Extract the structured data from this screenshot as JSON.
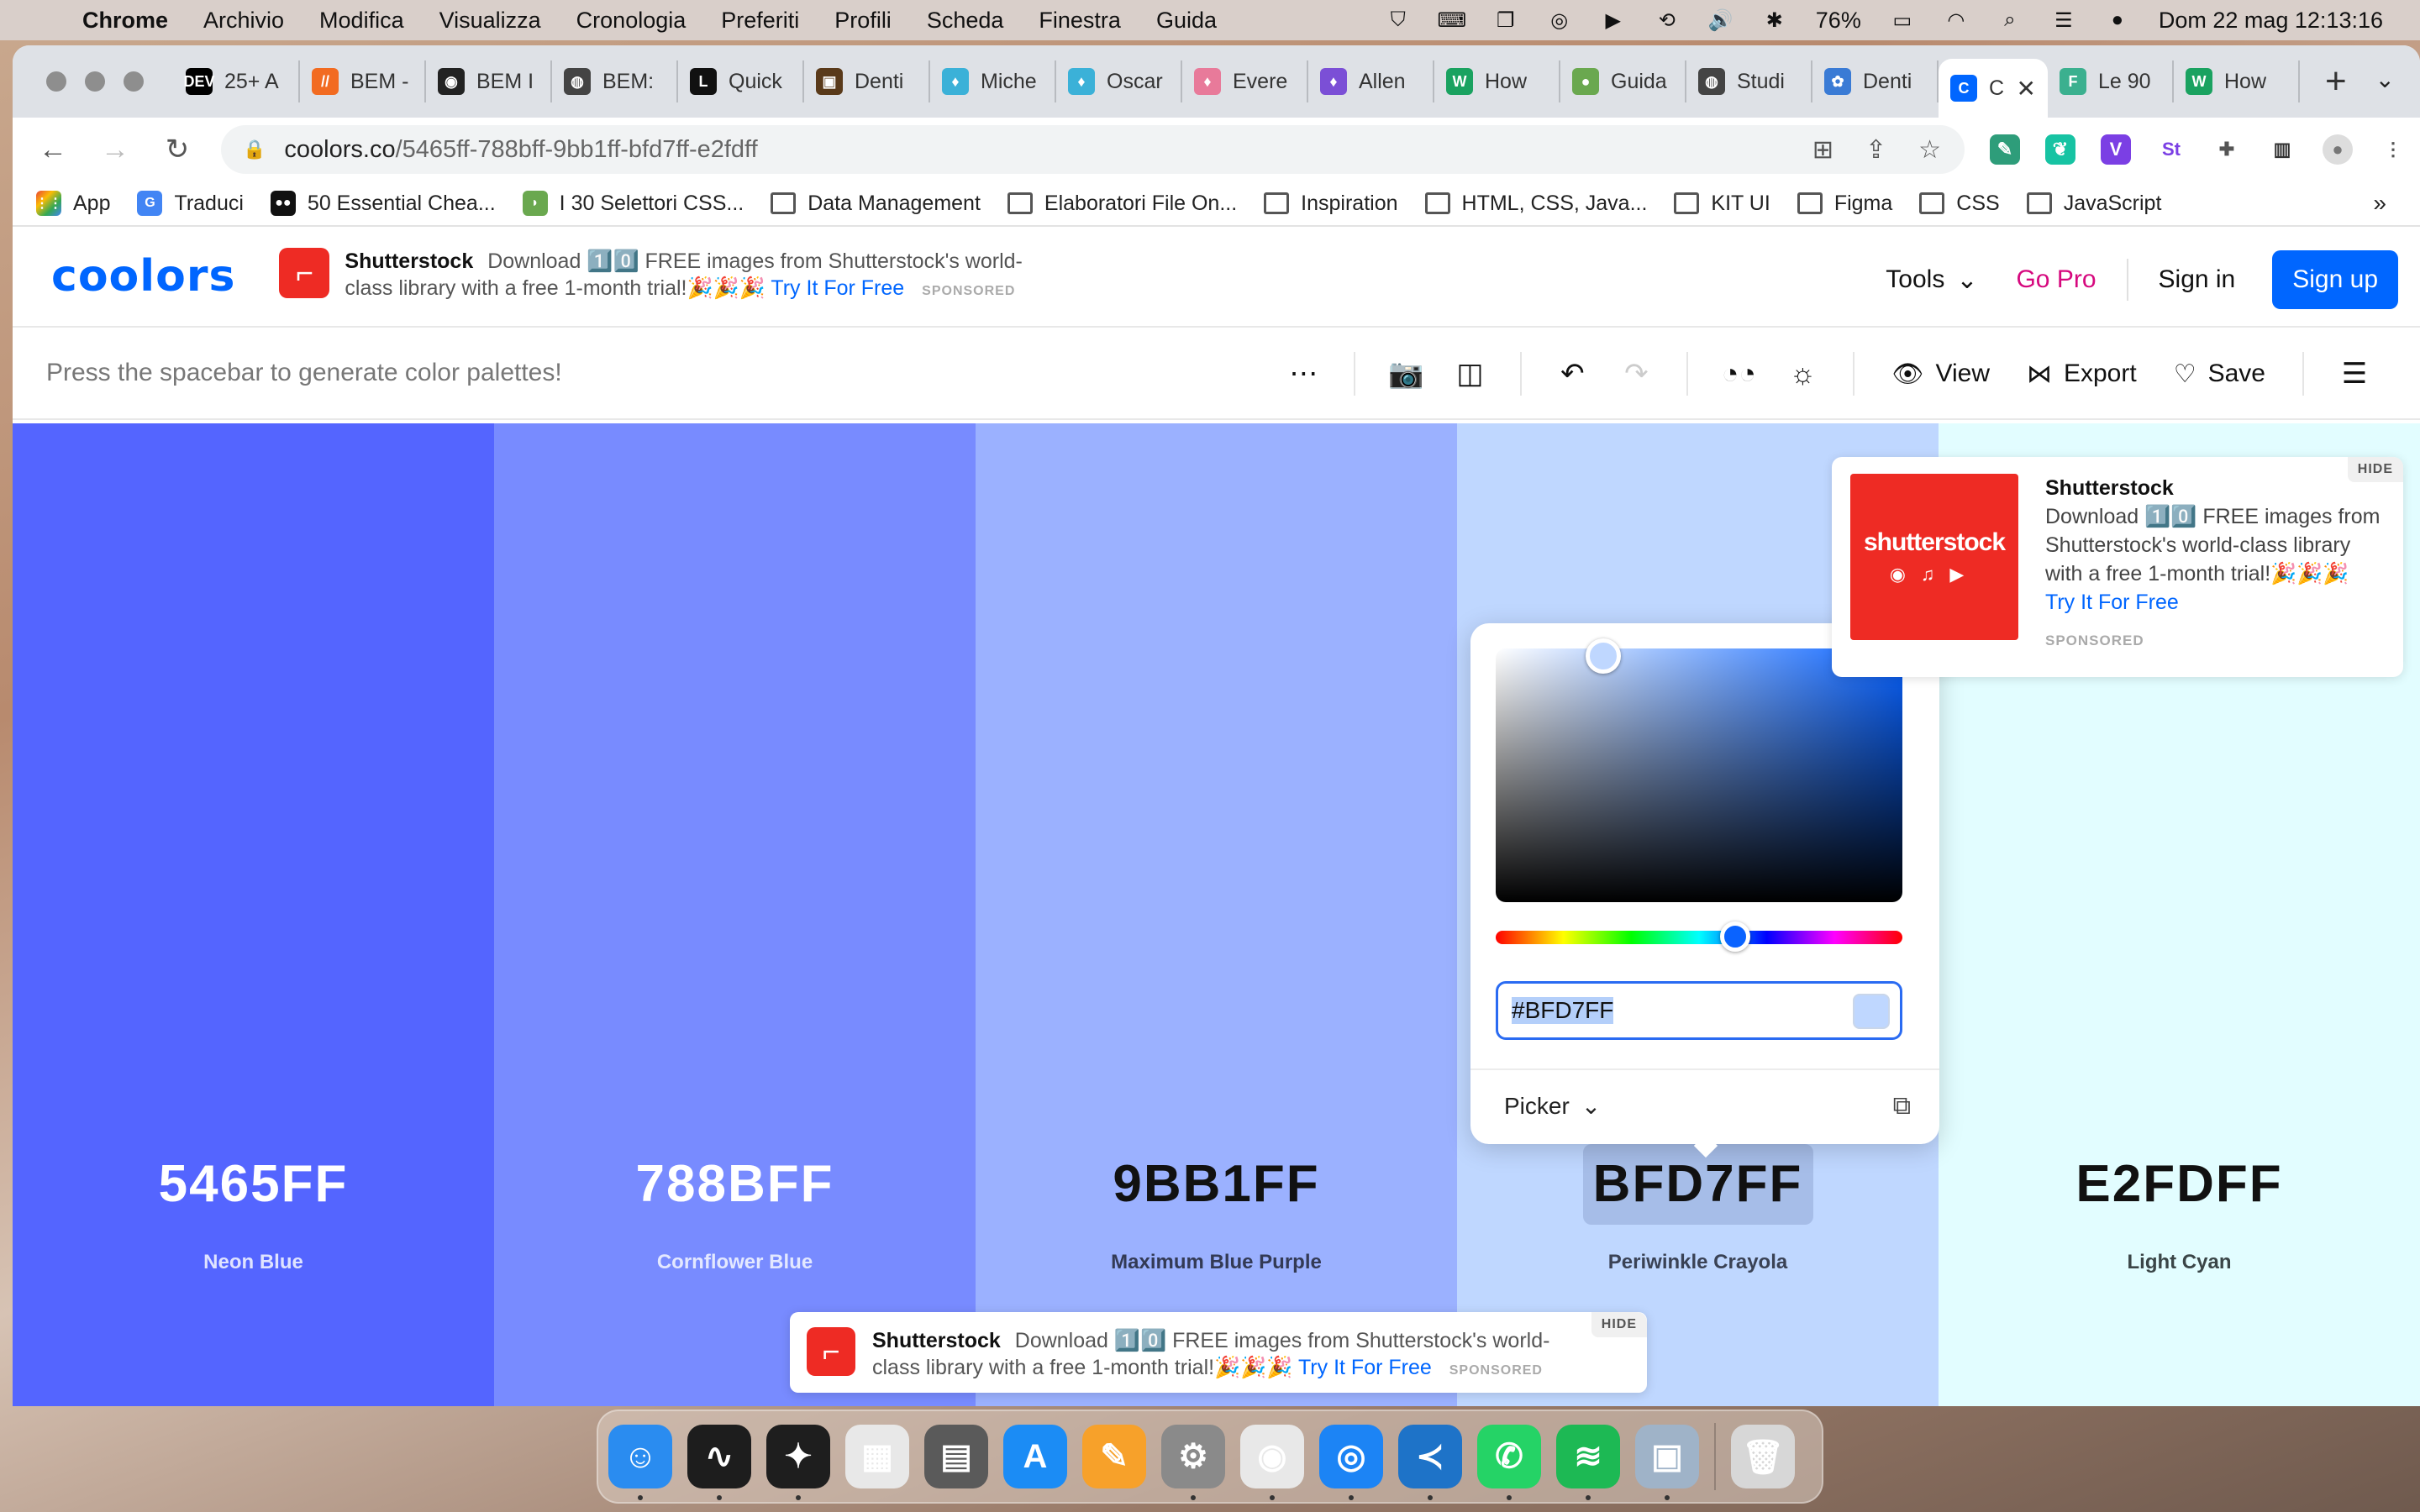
{
  "menubar": {
    "app": "Chrome",
    "items": [
      "Archivio",
      "Modifica",
      "Visualizza",
      "Cronologia",
      "Preferiti",
      "Profili",
      "Scheda",
      "Finestra",
      "Guida"
    ],
    "battery": "76%",
    "datetime": "Dom 22 mag  12:13:16"
  },
  "tabs": [
    {
      "title": "25+ A",
      "fav": "DEV",
      "color": "#000000"
    },
    {
      "title": "BEM -",
      "fav": "//",
      "color": "#f26b21"
    },
    {
      "title": "BEM I",
      "fav": "◉",
      "color": "#222222"
    },
    {
      "title": "BEM:",
      "fav": "◍",
      "color": "#444444"
    },
    {
      "title": "Quick",
      "fav": "L",
      "color": "#111111"
    },
    {
      "title": "Denti",
      "fav": "▣",
      "color": "#5a3a1a"
    },
    {
      "title": "Miche",
      "fav": "♦",
      "color": "#3bb1d8"
    },
    {
      "title": "Oscar",
      "fav": "♦",
      "color": "#3bb1d8"
    },
    {
      "title": "Evere",
      "fav": "♦",
      "color": "#e87a9a"
    },
    {
      "title": "Allen",
      "fav": "♦",
      "color": "#7b4fd6"
    },
    {
      "title": "How",
      "fav": "W",
      "color": "#1aa260"
    },
    {
      "title": "Guida",
      "fav": "●",
      "color": "#6aa84f"
    },
    {
      "title": "Studi",
      "fav": "◍",
      "color": "#444444"
    },
    {
      "title": "Denti",
      "fav": "✿",
      "color": "#3a7bd5"
    },
    {
      "title": "Co",
      "fav": "C",
      "color": "#0066ff",
      "active": true
    },
    {
      "title": "Le 90",
      "fav": "F",
      "color": "#3bb08f"
    },
    {
      "title": "How",
      "fav": "W",
      "color": "#1aa260"
    }
  ],
  "address": {
    "host": "coolors.co",
    "path": "/5465ff-788bff-9bb1ff-bfd7ff-e2fdff"
  },
  "bookmarks": [
    {
      "label": "App",
      "type": "apps"
    },
    {
      "label": "Traduci",
      "type": "icon",
      "color": "#4285f4",
      "glyph": "G"
    },
    {
      "label": "50 Essential Chea...",
      "type": "icon",
      "color": "#111111",
      "glyph": "●●"
    },
    {
      "label": "I 30 Selettori CSS...",
      "type": "icon",
      "color": "#6aa84f",
      "glyph": "◗"
    },
    {
      "label": "Data Management",
      "type": "folder"
    },
    {
      "label": "Elaboratori File On...",
      "type": "folder"
    },
    {
      "label": "Inspiration",
      "type": "folder"
    },
    {
      "label": "HTML, CSS, Java...",
      "type": "folder"
    },
    {
      "label": "KIT UI",
      "type": "folder"
    },
    {
      "label": "Figma",
      "type": "folder"
    },
    {
      "label": "CSS",
      "type": "folder"
    },
    {
      "label": "JavaScript",
      "type": "folder"
    }
  ],
  "site": {
    "logo": "coolors",
    "header_ad": {
      "brand": "Shutterstock",
      "text": "Download 1️⃣0️⃣ FREE images from Shutterstock's world-class library with a free 1-month trial!🎉🎉🎉",
      "cta": "Try It For Free",
      "sponsored": "SPONSORED"
    },
    "nav": {
      "tools": "Tools",
      "gopro": "Go Pro",
      "signin": "Sign in",
      "signup": "Sign up"
    },
    "hint": "Press the spacebar to generate color palettes!",
    "toolbar": {
      "view": "View",
      "export": "Export",
      "save": "Save"
    }
  },
  "palette": [
    {
      "hex": "5465FF",
      "name": "Neon Blue",
      "bg": "#5465ff",
      "fg": "#ffffff",
      "sub": "#dfe3ff"
    },
    {
      "hex": "788BFF",
      "name": "Cornflower Blue",
      "bg": "#788bff",
      "fg": "#ffffff",
      "sub": "#e3e8ff"
    },
    {
      "hex": "9BB1FF",
      "name": "Maximum Blue Purple",
      "bg": "#9bb1ff",
      "fg": "#111111",
      "sub": "#333a55"
    },
    {
      "hex": "BFD7FF",
      "name": "Periwinkle Crayola",
      "bg": "#bfd7ff",
      "fg": "#111111",
      "sub": "#3a4255"
    },
    {
      "hex": "E2FDFF",
      "name": "Light Cyan",
      "bg": "#e2fdff",
      "fg": "#111111",
      "sub": "#3a4547"
    }
  ],
  "picker": {
    "value": "#BFD7FF",
    "mode": "Picker"
  },
  "side_ad": {
    "brand": "Shutterstock",
    "text": "Download 1️⃣0️⃣ FREE images from Shutterstock's world-class library with a free 1-month trial!🎉🎉🎉",
    "cta": "Try It For Free",
    "sponsored": "SPONSORED",
    "hide": "HIDE",
    "image_text": "shutterstock"
  },
  "bottom_ad": {
    "brand": "Shutterstock",
    "text": "Download 1️⃣0️⃣ FREE images from Shutterstock's world-class library with a free 1-month trial!🎉🎉🎉",
    "cta": "Try It For Free",
    "sponsored": "SPONSORED",
    "hide": "HIDE"
  },
  "dock": [
    {
      "name": "finder",
      "color": "#2a8cf0",
      "glyph": "☺",
      "running": true
    },
    {
      "name": "activity-monitor",
      "color": "#1d1d1d",
      "glyph": "∿",
      "running": true
    },
    {
      "name": "figma",
      "color": "#1e1e1e",
      "glyph": "✦",
      "running": true
    },
    {
      "name": "launchpad",
      "color": "#e8e8e8",
      "glyph": "▦",
      "running": false
    },
    {
      "name": "calculator",
      "color": "#5a5a5a",
      "glyph": "▤",
      "running": false
    },
    {
      "name": "app-store",
      "color": "#1b8cf5",
      "glyph": "A",
      "running": false
    },
    {
      "name": "pages",
      "color": "#f7a12a",
      "glyph": "✎",
      "running": false
    },
    {
      "name": "system-preferences",
      "color": "#8a8a8a",
      "glyph": "⚙",
      "running": true
    },
    {
      "name": "chrome",
      "color": "#e8e8e8",
      "glyph": "◉",
      "running": true
    },
    {
      "name": "safari",
      "color": "#1c84f5",
      "glyph": "◎",
      "running": true
    },
    {
      "name": "vscode",
      "color": "#1e73c8",
      "glyph": "≺",
      "running": true
    },
    {
      "name": "whatsapp",
      "color": "#25d366",
      "glyph": "✆",
      "running": true
    },
    {
      "name": "spotify",
      "color": "#1db954",
      "glyph": "≋",
      "running": true
    },
    {
      "name": "preview",
      "color": "#9fb3c8",
      "glyph": "▣",
      "running": true
    },
    {
      "name": "trash",
      "color": "#d7d7d7",
      "glyph": "🗑",
      "running": false
    }
  ]
}
